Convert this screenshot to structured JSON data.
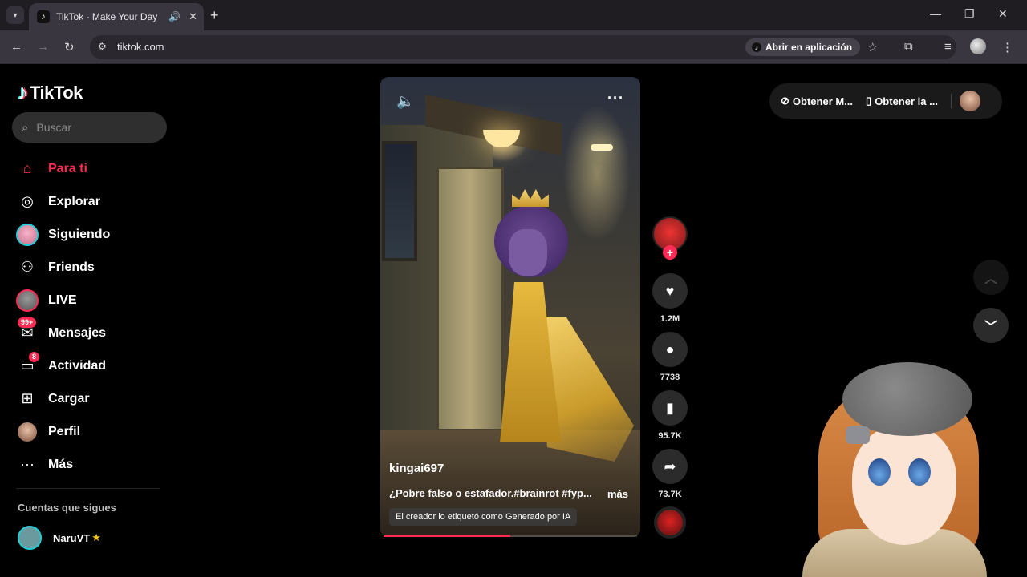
{
  "browser": {
    "tab_title": "TikTok - Make Your Day",
    "url": "tiktok.com",
    "open_app_label": "Abrir en aplicación"
  },
  "sidebar": {
    "logo_text": "TikTok",
    "search_placeholder": "Buscar",
    "items": [
      {
        "label": "Para ti",
        "icon": "home-icon",
        "active": true
      },
      {
        "label": "Explorar",
        "icon": "compass-icon"
      },
      {
        "label": "Siguiendo",
        "icon": "following-avatar"
      },
      {
        "label": "Friends",
        "icon": "friends-icon"
      },
      {
        "label": "LIVE",
        "icon": "live-avatar"
      },
      {
        "label": "Mensajes",
        "icon": "messages-icon",
        "badge": "99+"
      },
      {
        "label": "Actividad",
        "icon": "activity-icon",
        "badge": "8"
      },
      {
        "label": "Cargar",
        "icon": "upload-icon"
      },
      {
        "label": "Perfil",
        "icon": "profile-avatar"
      },
      {
        "label": "Más",
        "icon": "more-icon"
      }
    ],
    "following_title": "Cuentas que sigues",
    "following": [
      {
        "name": "NaruVT",
        "badge_icon": "star-icon"
      }
    ]
  },
  "video": {
    "author": "kingai697",
    "caption": "¿Pobre falso o estafador.#brainrot #fyp...",
    "more_label": "más",
    "ai_label": "El creador lo etiquetó como Generado por IA",
    "progress": 0.5
  },
  "actions": {
    "likes": "1.2M",
    "comments": "7738",
    "saves": "95.7K",
    "shares": "73.7K"
  },
  "top_right": {
    "get_coins": "Obtener M...",
    "get_app": "Obtener la ..."
  },
  "colors": {
    "accent": "#fe2c55",
    "cyan": "#25f4ee",
    "chrome_bg": "#3a3640"
  }
}
